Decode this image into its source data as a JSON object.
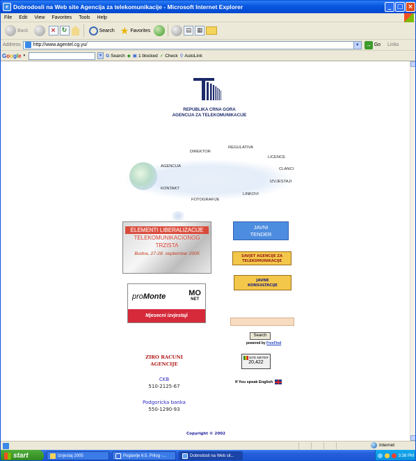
{
  "window": {
    "title": "Dobrodosli na Web site Agencija za telekomunikacije - Microsoft Internet Explorer",
    "buttons": {
      "minimize": "_",
      "maximize": "□",
      "close": "×"
    }
  },
  "menu": [
    "File",
    "Edit",
    "View",
    "Favorites",
    "Tools",
    "Help"
  ],
  "toolbar": {
    "back": "Back",
    "search": "Search",
    "favorites": "Favorites"
  },
  "address": {
    "label": "Address",
    "url": "http://www.agentel.cg.yu/",
    "go": "Go",
    "links": "Links"
  },
  "google_bar": {
    "logo": "Google",
    "search": "Search",
    "blocked": "1 blocked",
    "check": "Check",
    "autolink": "AutoLink"
  },
  "page": {
    "org_line1": "REPUBLIKA CRNA GORA",
    "org_line2": "AGENCIJA ZA TELEKOMUNIKACIJE",
    "nav": {
      "direktor": "DIREKTOR",
      "regulativa": "REGULATIVA",
      "licence": "LICENCE",
      "agencija": "AGENCIJA",
      "clanci": "CLANCI",
      "izvjestaji": "IZVJESTAJI",
      "kontakt": "KONTAKT",
      "linkovi": "LINKOVI",
      "fotografije": "FOTOGRAFIJE"
    },
    "banner_elementi": {
      "line1": "ELEMENTI LIBERALIZACIJE",
      "line2": "TELEKOMUNIKACIONOG",
      "line3": "TRZISTA",
      "date": "Budva, 27-28. septembar 2005"
    },
    "banner_promonte": {
      "logo_pro": "pro",
      "logo_monte": "Monte",
      "logo_mo": "MO",
      "logo_net": "NET",
      "caption": "Mjesecni izvjestaji"
    },
    "javni_tender": {
      "line1": "JAVNI",
      "line2": "TENDER"
    },
    "savjet": {
      "line1": "SAVJET AGENCIJE ZA",
      "line2": "TELEKOMUNIKACIJE"
    },
    "konsultacije": {
      "line1": "JAVNE",
      "line2": "KONSULTACIJE"
    },
    "search": {
      "button": "Search",
      "powered_by": "powered by",
      "freefind": "FreeFind"
    },
    "sitemeter": {
      "label": "SITE METER",
      "count": "20,422"
    },
    "english": "If You speak English",
    "ziro": {
      "line1": "ZIRO RACUNI",
      "line2": "AGENCIJE"
    },
    "banks": [
      {
        "name": "CKB",
        "account": "510-2125-67"
      },
      {
        "name": "Podgoricka banka",
        "account": "550-1290-93"
      }
    ],
    "copyright": "Copyright © 2002"
  },
  "statusbar": {
    "zone": "Internet"
  },
  "taskbar": {
    "start": "start",
    "tasks": [
      {
        "label": "Izvjestaj 2005",
        "icon": "folder-icon"
      },
      {
        "label": "Poglavlje 6.5. Prilog -...",
        "icon": "word-icon"
      },
      {
        "label": "Dobrodosli na Web sit...",
        "icon": "ie-icon"
      }
    ],
    "clock": "3:38 PM"
  }
}
